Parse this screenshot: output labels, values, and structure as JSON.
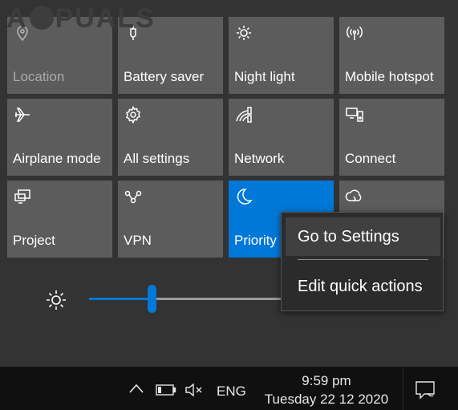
{
  "watermark": {
    "text_left": "A",
    "text_right": "PUALS"
  },
  "tiles": [
    {
      "label": "Location",
      "icon": "location-icon",
      "state": "disabled"
    },
    {
      "label": "Battery saver",
      "icon": "battery-saver-icon",
      "state": "off"
    },
    {
      "label": "Night light",
      "icon": "night-light-icon",
      "state": "off"
    },
    {
      "label": "Mobile hotspot",
      "icon": "mobile-hotspot-icon",
      "state": "off"
    },
    {
      "label": "Airplane mode",
      "icon": "airplane-icon",
      "state": "off"
    },
    {
      "label": "All settings",
      "icon": "gear-icon",
      "state": "off"
    },
    {
      "label": "Network",
      "icon": "network-icon",
      "state": "off"
    },
    {
      "label": "Connect",
      "icon": "connect-icon",
      "state": "off"
    },
    {
      "label": "Project",
      "icon": "project-icon",
      "state": "off"
    },
    {
      "label": "VPN",
      "icon": "vpn-icon",
      "state": "off"
    },
    {
      "label": "Priority",
      "icon": "moon-icon",
      "state": "on"
    },
    {
      "label": "",
      "icon": "focus-assist-icon",
      "state": "off"
    }
  ],
  "brightness": {
    "icon": "brightness-icon",
    "level_fraction": 0.3
  },
  "context_menu": {
    "items": [
      {
        "label": "Go to Settings",
        "hovered": true
      },
      {
        "label": "Edit quick actions",
        "hovered": false
      }
    ]
  },
  "taskbar": {
    "icons": [
      "chevron-up-icon",
      "battery-icon",
      "volume-muted-icon"
    ],
    "language": "ENG",
    "time": "9:59 pm",
    "date": "Tuesday 22 12 2020",
    "notification_icon": "action-center-icon"
  },
  "colors": {
    "accent": "#0078d7",
    "tile": "#5c5c5c",
    "panel": "#333333",
    "taskbar": "#101010"
  }
}
